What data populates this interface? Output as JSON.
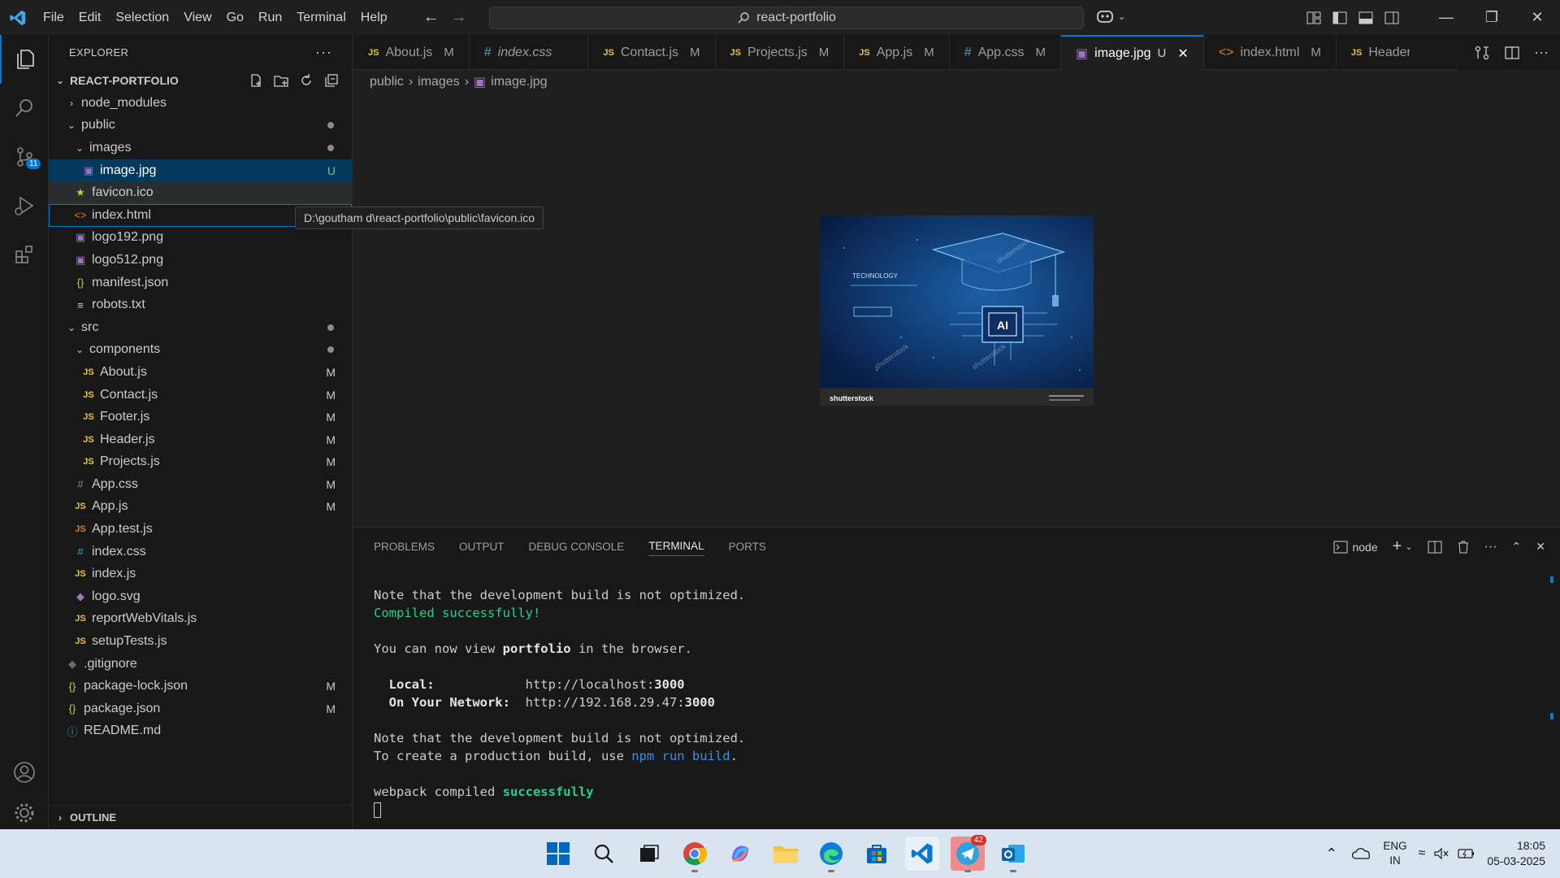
{
  "menu": [
    "File",
    "Edit",
    "Selection",
    "View",
    "Go",
    "Run",
    "Terminal",
    "Help"
  ],
  "search": "react-portfolio",
  "activity": {
    "scm_badge": "11"
  },
  "sidebar": {
    "title": "EXPLORER",
    "project": "REACT-PORTFOLIO",
    "items": [
      {
        "label": "node_modules",
        "icon": "chevron-right",
        "kind": "folder"
      },
      {
        "label": "public",
        "icon": "chevron-down",
        "kind": "folder"
      },
      {
        "label": "images",
        "icon": "chevron-down",
        "kind": "folder"
      },
      {
        "label": "image.jpg",
        "tag": "U"
      },
      {
        "label": "favicon.ico"
      },
      {
        "label": "index.html"
      },
      {
        "label": "logo192.png"
      },
      {
        "label": "logo512.png"
      },
      {
        "label": "manifest.json"
      },
      {
        "label": "robots.txt"
      },
      {
        "label": "src",
        "icon": "chevron-down",
        "kind": "folder"
      },
      {
        "label": "components",
        "icon": "chevron-down",
        "kind": "folder"
      },
      {
        "label": "About.js",
        "tag": "M"
      },
      {
        "label": "Contact.js",
        "tag": "M"
      },
      {
        "label": "Footer.js",
        "tag": "M"
      },
      {
        "label": "Header.js",
        "tag": "M"
      },
      {
        "label": "Projects.js",
        "tag": "M"
      },
      {
        "label": "App.css",
        "tag": "M"
      },
      {
        "label": "App.js",
        "tag": "M"
      },
      {
        "label": "App.test.js"
      },
      {
        "label": "index.css"
      },
      {
        "label": "index.js"
      },
      {
        "label": "logo.svg"
      },
      {
        "label": "reportWebVitals.js"
      },
      {
        "label": "setupTests.js"
      },
      {
        "label": ".gitignore"
      },
      {
        "label": "package-lock.json",
        "tag": "M"
      },
      {
        "label": "package.json",
        "tag": "M"
      },
      {
        "label": "README.md"
      }
    ],
    "outline": "OUTLINE",
    "tooltip": "D:\\goutham d\\react-portfolio\\public\\favicon.ico"
  },
  "tabs": [
    {
      "label": "About.js",
      "tag": "M"
    },
    {
      "label": "index.css",
      "tag": ""
    },
    {
      "label": "Contact.js",
      "tag": "M"
    },
    {
      "label": "Projects.js",
      "tag": "M"
    },
    {
      "label": "App.js",
      "tag": "M"
    },
    {
      "label": "App.css",
      "tag": "M"
    },
    {
      "label": "image.jpg",
      "tag": "U"
    },
    {
      "label": "index.html",
      "tag": "M"
    },
    {
      "label": "Header.js",
      "tag": ""
    }
  ],
  "breadcrumb": [
    "public",
    "images",
    "image.jpg"
  ],
  "image": {
    "heading": "TECHNOLOGY",
    "chip": "AI",
    "watermark": "shutterstock"
  },
  "panel": {
    "tabs": [
      "PROBLEMS",
      "OUTPUT",
      "DEBUG CONSOLE",
      "TERMINAL",
      "PORTS"
    ],
    "terminal_name": "node",
    "lines": {
      "l1": "Note that the development build is not optimized.",
      "l2": "Compiled successfully!",
      "l3a": "You can now view ",
      "l3b": "portfolio",
      "l3c": " in the browser.",
      "l4a": "  Local:            ",
      "l4b": "http://localhost:",
      "l4c": "3000",
      "l5a": "  On Your Network:  ",
      "l5b": "http://192.168.29.47:",
      "l5c": "3000",
      "l6": "Note that the development build is not optimized.",
      "l7a": "To create a production build, use ",
      "l7b": "npm run build",
      "l7c": ".",
      "l8a": "webpack compiled ",
      "l8b": "successfully"
    }
  },
  "taskbar": {
    "telegram_badge": "42",
    "lang1": "ENG",
    "lang2": "IN",
    "time": "18:05",
    "date": "05-03-2025"
  }
}
